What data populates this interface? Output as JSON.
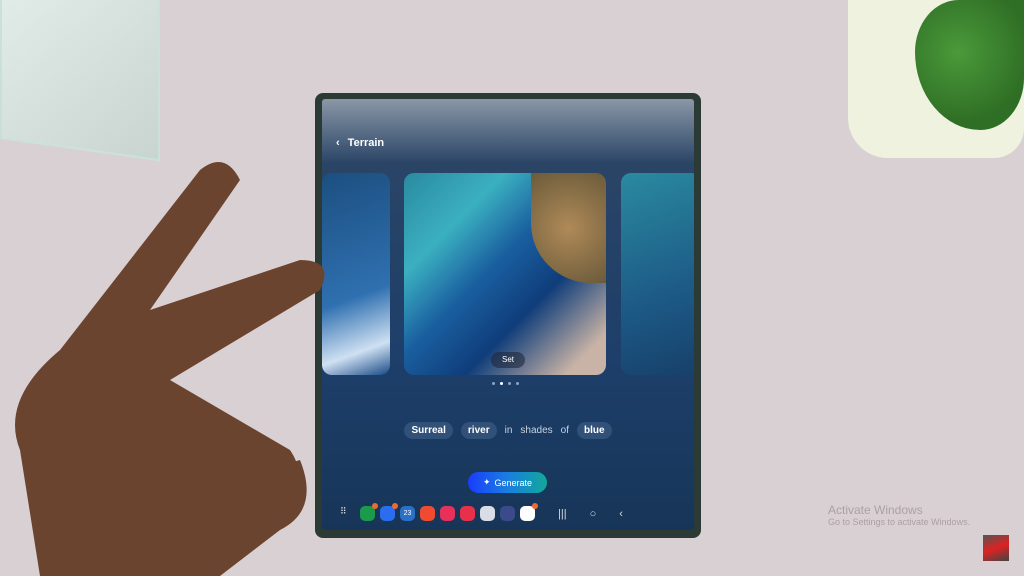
{
  "header": {
    "title": "Terrain",
    "back_icon": "chevron-left-icon"
  },
  "carousel": {
    "set_label": "Set",
    "pages": 4,
    "active_page": 2
  },
  "prompt": {
    "parts": [
      {
        "text": "Surreal",
        "chip": true
      },
      {
        "text": "river",
        "chip": true
      },
      {
        "text": "in",
        "chip": false
      },
      {
        "text": "shades",
        "chip": false
      },
      {
        "text": "of",
        "chip": false
      },
      {
        "text": "blue",
        "chip": true
      }
    ]
  },
  "generate": {
    "label": "Generate",
    "icon": "sparkle-icon"
  },
  "dock": {
    "apps": [
      {
        "name": "apps-grid",
        "color": "transparent",
        "badge": false
      },
      {
        "name": "phone",
        "color": "#1a9a4a",
        "badge": true
      },
      {
        "name": "messages",
        "color": "#2a6df0",
        "badge": true
      },
      {
        "name": "calendar",
        "color": "#2a70c8",
        "badge": false,
        "text": "23"
      },
      {
        "name": "notes",
        "color": "#f04a30",
        "badge": false
      },
      {
        "name": "gallery",
        "color": "#e8305a",
        "badge": false
      },
      {
        "name": "screen-recorder",
        "color": "#e8304a",
        "badge": false
      },
      {
        "name": "folder",
        "color": "#d8dde6",
        "badge": false
      },
      {
        "name": "settings",
        "color": "#3a4a8a",
        "badge": false
      },
      {
        "name": "play-store",
        "color": "#ffffff",
        "badge": true
      }
    ],
    "nav": [
      "|||",
      "○",
      "‹"
    ]
  },
  "watermark": {
    "title": "Activate Windows",
    "subtitle": "Go to Settings to activate Windows."
  }
}
